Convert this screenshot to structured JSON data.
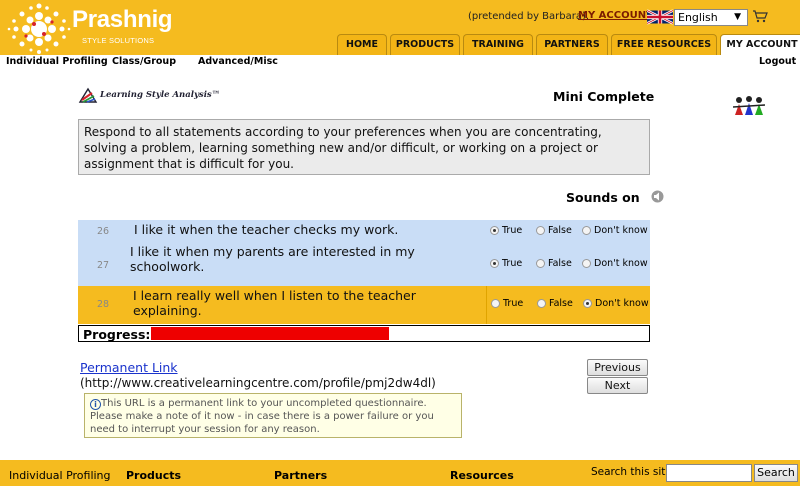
{
  "brand": {
    "name": "Prashnig",
    "subtitle": "STYLE SOLUTIONS"
  },
  "header": {
    "pretended_text": "(pretended by Barbara).",
    "my_account_link": "MY ACCOUNT",
    "language": "English",
    "nav_tabs": [
      "HOME",
      "PRODUCTS",
      "TRAINING",
      "PARTNERS",
      "FREE RESOURCES",
      "MY ACCOUNT"
    ],
    "active_tab": "MY ACCOUNT"
  },
  "subnav": {
    "individual_profiling": "Individual Profiling",
    "class_group": "Class/Group",
    "advanced_misc": "Advanced/Misc",
    "logout": "Logout"
  },
  "main": {
    "lsa_logo_text": "Learning Style Analysis™",
    "title": "Mini Complete",
    "instructions": "Respond to all statements according to your preferences when you are concentrating, solving a problem, learning something new and/or difficult, or working on a project or assignment that is difficult for you.",
    "sounds_label": "Sounds on",
    "option_labels": [
      "True",
      "False",
      "Don't know"
    ],
    "questions": [
      {
        "number": "26",
        "text": "I like it when the teacher checks my work.",
        "selected": "True",
        "highlighted": false
      },
      {
        "number": "27",
        "text": "I like it when my parents are interested in my schoolwork.",
        "selected": "True",
        "highlighted": false
      },
      {
        "number": "28",
        "text": "I learn really well when I listen to the teacher explaining.",
        "selected": "Don't know",
        "highlighted": true
      }
    ],
    "progress_label": "Progress:",
    "progress_fraction": 0.48,
    "permanent_link_label": "Permanent Link",
    "permanent_link_url": "(http://www.creativelearningcentre.com/profile/pmj2dw4dl)",
    "info_text": "This URL is a permanent link to your uncompleted questionnaire. Please make a note of it now - in case there is a power failure or you need to interrupt your session for any reason.",
    "previous_label": "Previous",
    "next_label": "Next"
  },
  "footer": {
    "individual_profiling": "Individual Profiling",
    "products": "Products",
    "partners": "Partners",
    "resources": "Resources",
    "search_label": "Search this site:",
    "search_button": "Search"
  },
  "colors": {
    "header_bg": "#f5bb1f",
    "row_blue": "#c9ddf6",
    "row_highlight": "#f5bb1f",
    "progress_fill": "#ee0000",
    "link_blue": "#1a33cc"
  }
}
